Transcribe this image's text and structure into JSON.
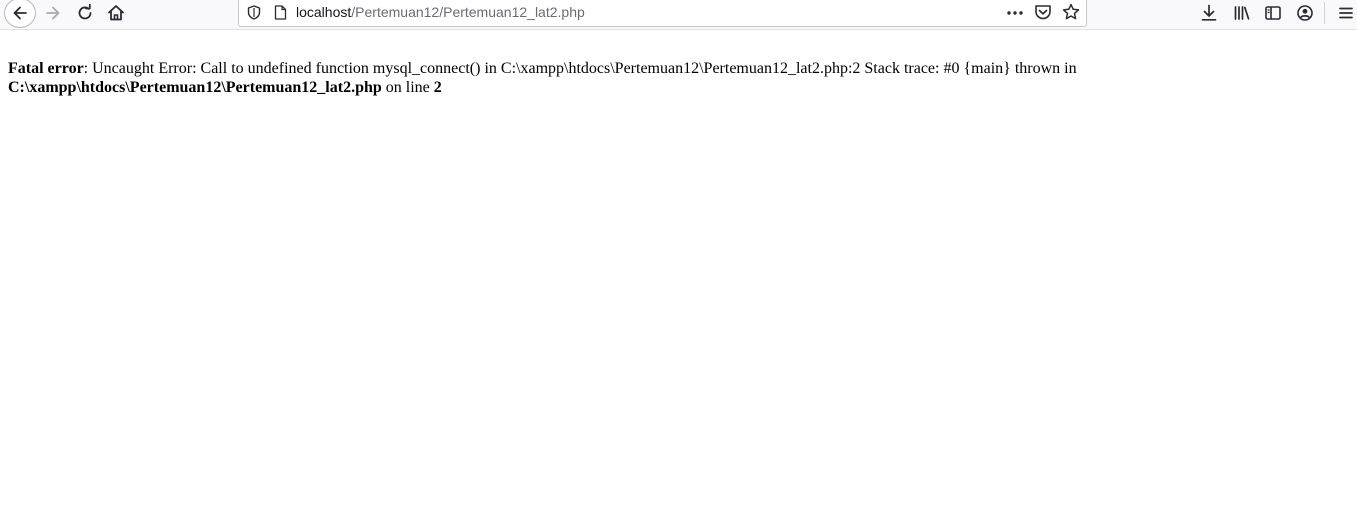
{
  "browser": {
    "url_host": "localhost",
    "url_path": "/Pertemuan12/Pertemuan12_lat2.php"
  },
  "error": {
    "label": "Fatal error",
    "message": ": Uncaught Error: Call to undefined function mysql_connect() in C:\\xampp\\htdocs\\Pertemuan12\\Pertemuan12_lat2.php:2 Stack trace: #0 {main} thrown in ",
    "file_path": "C:\\xampp\\htdocs\\Pertemuan12\\Pertemuan12_lat2.php",
    "line_prefix": " on line ",
    "line_number": "2"
  }
}
